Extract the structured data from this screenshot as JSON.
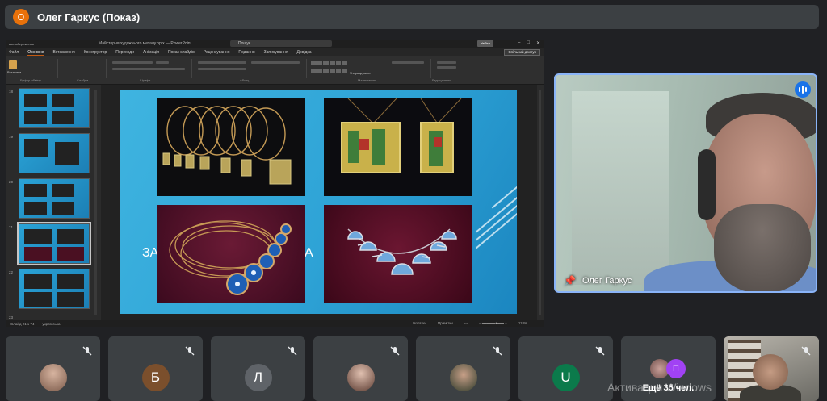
{
  "presenter": {
    "avatar_letter": "О",
    "title": "Олег Гаркус (Показ)",
    "avatar_color": "#e8710a"
  },
  "powerpoint": {
    "title_bar": {
      "autosave": "Автозбереження",
      "document": "Майстерня художнього металу.pptx — PowerPoint",
      "search": "Пошук",
      "enter_button": "Увійти"
    },
    "menu_tabs": [
      "Файл",
      "Основне",
      "Вставлення",
      "Конструктор",
      "Переходи",
      "Анімація",
      "Показ слайдів",
      "Рецензування",
      "Подання",
      "Записування",
      "Довідка"
    ],
    "active_tab": "Основне",
    "share_button": "Спільний доступ",
    "ribbon_groups": [
      "Буфер обміну",
      "Слайди",
      "Шрифт",
      "Абзац",
      "Малювання",
      "Редагування"
    ],
    "paste_label": "Вставити",
    "arrange_label": "Упорядкувати",
    "thumbnail_numbers": [
      "18",
      "19",
      "20",
      "21",
      "22",
      "23"
    ],
    "status": {
      "slide_info": "Слайд 21 з 74",
      "language": "українська",
      "notes": "Нотатки",
      "comments": "Примітки",
      "zoom": "118%"
    }
  },
  "pinned": {
    "name": "Олег Гаркус",
    "ring_color": "#8ab4f8"
  },
  "participants": [
    {
      "type": "photo"
    },
    {
      "letter": "Б",
      "color": "#7b4f2c"
    },
    {
      "letter": "Л",
      "color": "#5f6368"
    },
    {
      "type": "photo"
    },
    {
      "type": "photo"
    },
    {
      "letter": "U",
      "color": "#0b7a4b"
    },
    {
      "letter": "П",
      "more": "Ещё 35 чел."
    },
    {
      "type": "video"
    }
  ],
  "watermark": "Активация Windows"
}
